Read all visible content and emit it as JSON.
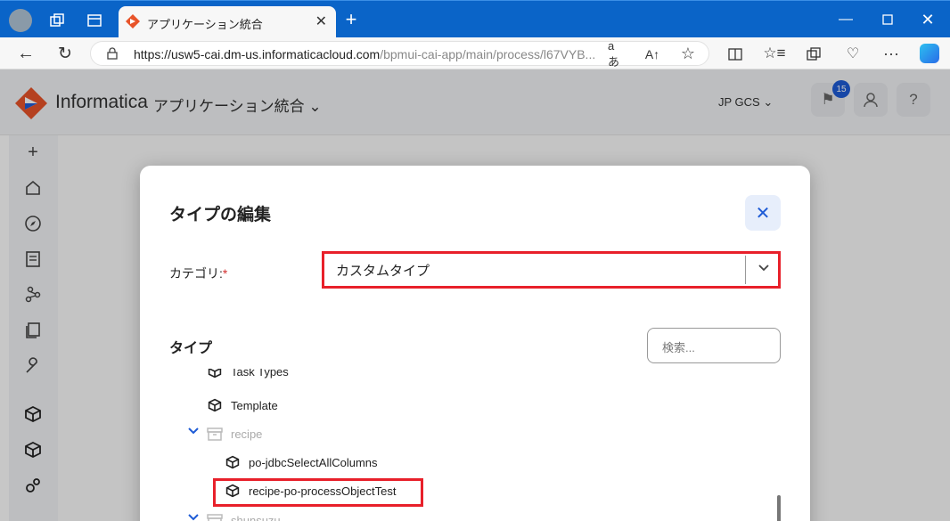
{
  "browser": {
    "tab_title": "アプリケーション統合",
    "url_base": "https://usw5-cai.dm-us.informaticacloud.com",
    "url_path": "/bpmui-cai-app/main/process/l67VYB..."
  },
  "app": {
    "brand": "Informatica",
    "product": "アプリケーション統合",
    "org": "JP GCS",
    "notification_count": "15"
  },
  "modal": {
    "title": "タイプの編集",
    "category_label": "カテゴリ:",
    "required_mark": "*",
    "category_value": "カスタムタイプ",
    "type_label": "タイプ",
    "search_placeholder": "検索...",
    "tree": [
      {
        "label": "Task Types",
        "kind": "cube"
      },
      {
        "label": "Template",
        "kind": "cube"
      },
      {
        "label": "recipe",
        "kind": "folder",
        "expanded": true
      },
      {
        "label": "po-jdbcSelectAllColumns",
        "kind": "cube"
      },
      {
        "label": "recipe-po-processObjectTest",
        "kind": "cube",
        "selected": true
      },
      {
        "label": "shunsuzu",
        "kind": "folder",
        "expanded": true
      }
    ]
  },
  "colors": {
    "accent": "#1e5bd6",
    "highlight": "#e8202a",
    "browser_bar": "#0a64c8"
  }
}
